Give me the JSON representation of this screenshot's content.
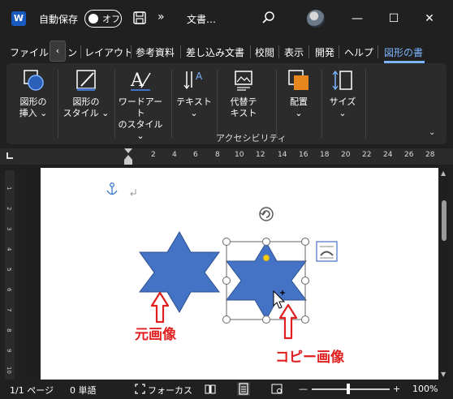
{
  "titlebar": {
    "app_icon": "W",
    "autosave_label": "自動保存",
    "autosave_state": "オフ",
    "more_label": "»",
    "doc_title": "文書…",
    "minimize": "—",
    "maximize": "☐",
    "close": "✕"
  },
  "tabs": {
    "scroll_left": "‹",
    "items": [
      "ファイル",
      "ン",
      "レイアウト",
      "参考資料",
      "差し込み文書",
      "校閲",
      "表示",
      "開発",
      "ヘルプ",
      "図形の書"
    ],
    "active": "図形の書"
  },
  "ribbon": {
    "insert_shape": [
      "図形の",
      "挿入 ⌄"
    ],
    "shape_style": [
      "図形の",
      "スタイル ⌄"
    ],
    "wordart_style": [
      "ワードアート",
      "のスタイル ⌄"
    ],
    "text": [
      "テキスト",
      "⌄"
    ],
    "alt_text": [
      "代替テ",
      "キスト"
    ],
    "arrange": [
      "配置",
      "⌄"
    ],
    "size": [
      "サイズ",
      "⌄"
    ],
    "group_accessibility": "アクセシビリティ",
    "collapse": "⌄"
  },
  "ruler": {
    "ticks": [
      "2",
      "4",
      "6",
      "8",
      "10",
      "12",
      "14",
      "16",
      "18",
      "20",
      "22",
      "24",
      "26",
      "28"
    ],
    "vticks": [
      "1",
      "2",
      "3",
      "4",
      "5",
      "6",
      "7",
      "8",
      "9",
      "10"
    ]
  },
  "document": {
    "label_original": "元画像",
    "label_copy": "コピー画像",
    "shape_color": "#4472c4",
    "annotation_color": "#e02020"
  },
  "statusbar": {
    "page": "1/1 ページ",
    "words": "0 単語",
    "focus": "フォーカス",
    "zoom_minus": "—",
    "zoom_plus": "+",
    "zoom": "100%"
  }
}
